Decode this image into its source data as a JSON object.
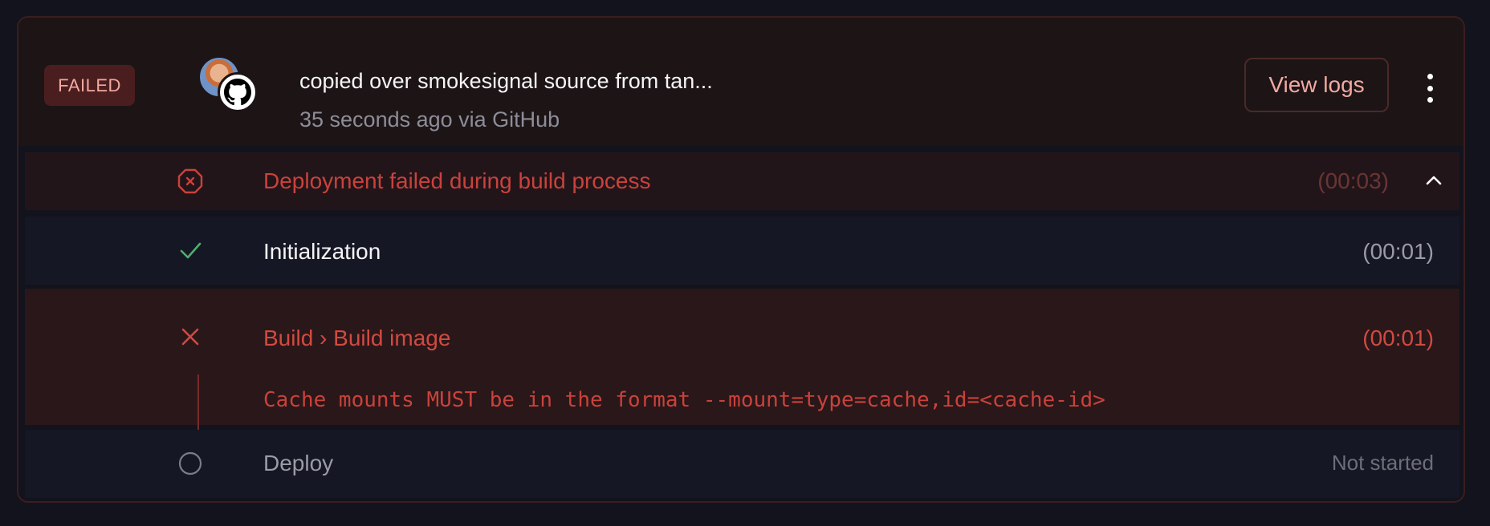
{
  "deployment": {
    "status_badge": "FAILED",
    "commit_title": "copied over smokesignal source from tan...",
    "commit_meta": "35 seconds ago via GitHub",
    "view_logs_label": "View logs",
    "menu_icon": "kebab-menu-icon",
    "source_icon": "github-icon",
    "summary": {
      "message": "Deployment failed during build process",
      "duration": "(00:03)",
      "icon": "error-octagon-icon",
      "toggle_icon": "chevron-up-icon"
    },
    "steps": [
      {
        "label": "Initialization",
        "duration": "(00:01)",
        "status": "success",
        "icon": "check-icon"
      },
      {
        "label": "Build › Build image",
        "duration": "(00:01)",
        "status": "failed",
        "icon": "x-icon",
        "error": "Cache mounts MUST be in the format --mount=type=cache,id=<cache-id>"
      },
      {
        "label": "Deploy",
        "duration": "Not started",
        "status": "pending",
        "icon": "circle-icon"
      }
    ]
  },
  "colors": {
    "background": "#13131d",
    "header_bg": "#1d1416",
    "failed_accent": "#c9423b",
    "success_accent": "#4caf6e",
    "badge_bg": "#4a1e1e"
  }
}
